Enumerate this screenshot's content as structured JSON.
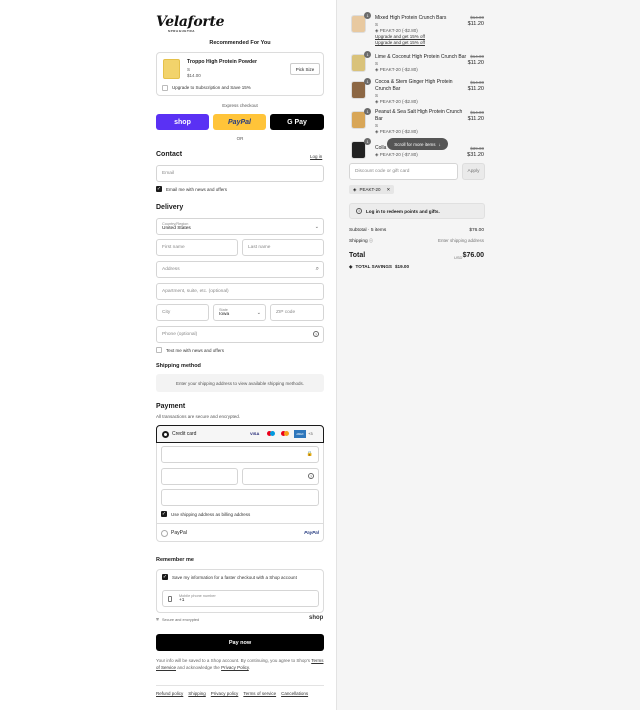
{
  "brand": {
    "logo_text": "Velaforte",
    "tagline": "SPRAGUETRA"
  },
  "recommended": {
    "title": "Recommended For You",
    "product_name": "Troppo High Protein Powder",
    "product_variant": "S",
    "product_price": "$14.00",
    "pick_size_label": "Pick Size",
    "subscription_label": "Upgrade to Subscription and Save 15%"
  },
  "express": {
    "label": "Express checkout",
    "shop_label": "shop",
    "paypal_label": "PayPal",
    "gpay_label": "G Pay",
    "or_label": "OR"
  },
  "contact": {
    "title": "Contact",
    "login_label": "Log in",
    "email_placeholder": "Email",
    "news_label": "Email me with news and offers"
  },
  "delivery": {
    "title": "Delivery",
    "country_label": "Country/Region",
    "country_value": "United States",
    "first_name": "First name",
    "last_name": "Last name",
    "address": "Address",
    "apartment": "Apartment, suite, etc. (optional)",
    "city": "City",
    "state_label": "State",
    "state_value": "Iowa",
    "zip": "ZIP code",
    "phone": "Phone (optional)",
    "text_label": "Text me with news and offers"
  },
  "shipping": {
    "title": "Shipping method",
    "message": "Enter your shipping address to view available shipping methods."
  },
  "payment": {
    "title": "Payment",
    "subtitle": "All transactions are secure and encrypted.",
    "credit_label": "Credit card",
    "card_brands": [
      "VISA",
      "MC",
      "MAE",
      "AMEX"
    ],
    "more_brands": "+3",
    "billing_label": "Use shipping address as billing address",
    "paypal_label": "PayPal"
  },
  "remember": {
    "title": "Remember me",
    "save_label": "Save my information for a faster checkout with a Shop account",
    "phone_label": "Mobile phone number",
    "phone_value": "+1",
    "secure_label": "Secure and encrypted",
    "shop_label": "shop"
  },
  "pay_now": "Pay now",
  "legal": {
    "text": "Your info will be saved to a Shop account. By continuing, you agree to Shop's",
    "terms": "Terms of Service",
    "and": "and acknowledge the",
    "privacy": "Privacy Policy",
    "end": "."
  },
  "footer_links": [
    "Refund policy",
    "Shipping",
    "Privacy policy",
    "Terms of service",
    "Cancellations"
  ],
  "cart": {
    "items": [
      {
        "qty": "1",
        "name": "Mixed High Protein Crunch Bars",
        "variant": "S",
        "discount": "PEAKT-20 (-$2.80)",
        "old_price": "$14.00",
        "price": "$11.20",
        "upgrade1": "Upgrade and get 15% off",
        "upgrade2": "Upgrade and get 15% off"
      },
      {
        "qty": "1",
        "name": "Lime & Coconut High Protein Crunch Bar",
        "variant": "S",
        "discount": "PEAKT-20 (-$2.80)",
        "old_price": "$14.00",
        "price": "$11.20"
      },
      {
        "qty": "1",
        "name": "Cocoa & Stem Ginger High Protein Crunch Bar",
        "variant": "S",
        "discount": "PEAKT-20 (-$2.80)",
        "old_price": "$14.00",
        "price": "$11.20"
      },
      {
        "qty": "1",
        "name": "Peanut & Sea Salt High Protein Crunch Bar",
        "variant": "S",
        "discount": "PEAKT-20 (-$2.80)",
        "old_price": "$14.00",
        "price": "$11.20"
      },
      {
        "qty": "1",
        "name": "Colla",
        "discount": "PEAKT-20 (-$7.80)",
        "old_price": "$39.00",
        "price": "$31.20"
      }
    ],
    "scroll_label": "Scroll for more items",
    "discount_placeholder": "Discount code or gift card",
    "apply_label": "Apply",
    "applied_code": "PEAKT-20",
    "login_text": "Log in to redeem points and gifts.",
    "subtotal_label": "Subtotal · 5 items",
    "subtotal_value": "$76.00",
    "shipping_label": "Shipping",
    "shipping_value": "Enter shipping address",
    "total_label": "Total",
    "currency": "USD",
    "total_value": "$76.00",
    "savings_label": "TOTAL SAVINGS",
    "savings_value": "$19.00"
  },
  "colors": {
    "shop": "#5a31f4",
    "paypal": "#ffc439",
    "dark": "#000000"
  }
}
